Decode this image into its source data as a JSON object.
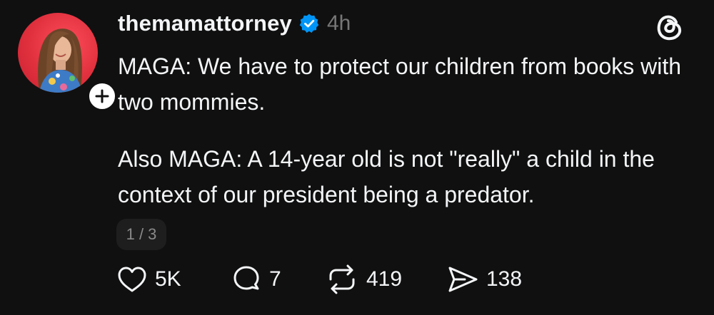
{
  "post": {
    "username": "themamattorney",
    "verified": true,
    "timestamp": "4h",
    "body": [
      "MAGA: We have to protect our children from books with two mommies.",
      "Also MAGA: A 14-year old is not \"really\" a child in the context of our president being a predator."
    ],
    "pager": "1 / 3",
    "icons": {
      "app": "threads-logo-icon",
      "verified": "verified-check-icon",
      "follow": "plus-icon",
      "like": "heart-icon",
      "reply": "speech-bubble-icon",
      "repost": "repost-arrows-icon",
      "share": "paper-plane-icon"
    },
    "colors": {
      "background": "#101010",
      "text": "#f3f5f7",
      "muted": "#777777",
      "verified": "#0095f6",
      "avatar_bg": "#e0303e"
    },
    "actions": {
      "likes": "5K",
      "replies": "7",
      "reposts": "419",
      "shares": "138"
    }
  }
}
